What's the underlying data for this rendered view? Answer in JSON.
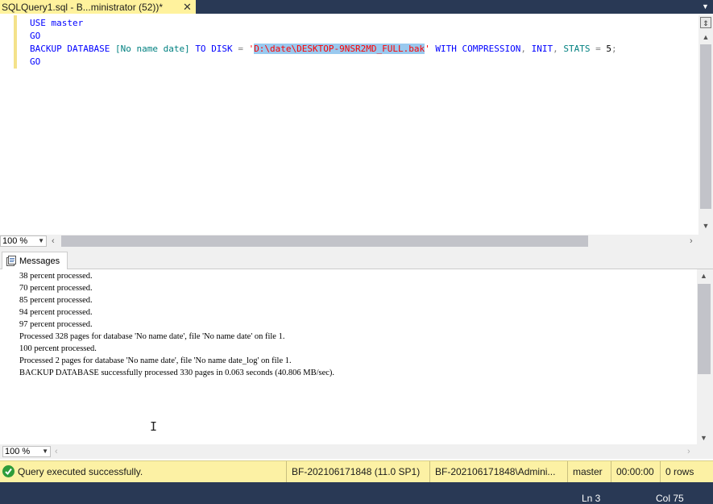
{
  "tab": {
    "title": "SQLQuery1.sql - B...ministrator (52))*",
    "close_glyph": "✕",
    "dropdown_glyph": "▼"
  },
  "editor": {
    "lines": [
      [
        {
          "t": "USE ",
          "c": "kw"
        },
        {
          "t": "master",
          "c": "kw"
        }
      ],
      [
        {
          "t": "GO",
          "c": "kw"
        }
      ],
      [
        {
          "t": "BACKUP ",
          "c": "kw"
        },
        {
          "t": "DATABASE ",
          "c": "kw"
        },
        {
          "t": "[No name date]",
          "c": "tx"
        },
        {
          "t": " ",
          "c": ""
        },
        {
          "t": "TO ",
          "c": "kw"
        },
        {
          "t": "DISK ",
          "c": "kw"
        },
        {
          "t": "= ",
          "c": "gy"
        },
        {
          "t": "'",
          "c": "str"
        },
        {
          "t": "D:\\date\\DESKTOP-9NSR2MD_FULL.bak",
          "c": "str sel"
        },
        {
          "t": "'",
          "c": "str"
        },
        {
          "t": " ",
          "c": ""
        },
        {
          "t": "WITH ",
          "c": "kw"
        },
        {
          "t": "COMPRESSION",
          "c": "kw"
        },
        {
          "t": ", ",
          "c": "gy"
        },
        {
          "t": "INIT",
          "c": "kw"
        },
        {
          "t": ", ",
          "c": "gy"
        },
        {
          "t": "STATS ",
          "c": "tx"
        },
        {
          "t": "= ",
          "c": "gy"
        },
        {
          "t": "5",
          "c": ""
        },
        {
          "t": ";",
          "c": "gy"
        }
      ],
      [
        {
          "t": "GO",
          "c": "kw"
        }
      ]
    ],
    "zoom": "100 %"
  },
  "messages_tab": {
    "label": "Messages"
  },
  "messages": {
    "lines": [
      "38 percent processed.",
      "70 percent processed.",
      "85 percent processed.",
      "94 percent processed.",
      "97 percent processed.",
      "Processed 328 pages for database 'No name date', file 'No name date' on file 1.",
      "100 percent processed.",
      "Processed 2 pages for database 'No name date', file 'No name date_log' on file 1.",
      "BACKUP DATABASE successfully processed 330 pages in 0.063 seconds (40.806 MB/sec)."
    ],
    "zoom": "100 %"
  },
  "status": {
    "message": "Query executed successfully.",
    "server": "BF-202106171848 (11.0 SP1)",
    "user": "BF-202106171848\\Admini...",
    "database": "master",
    "elapsed": "00:00:00",
    "rows": "0 rows"
  },
  "position": {
    "line": "Ln 3",
    "col": "Col 75"
  },
  "colors": {
    "keyword": "#0000ff",
    "string": "#ff0000",
    "identifier": "#008080",
    "operator": "#808080",
    "status_bar": "#fcf1a4",
    "tab_active": "#fff29d",
    "chrome_dark": "#293955"
  }
}
